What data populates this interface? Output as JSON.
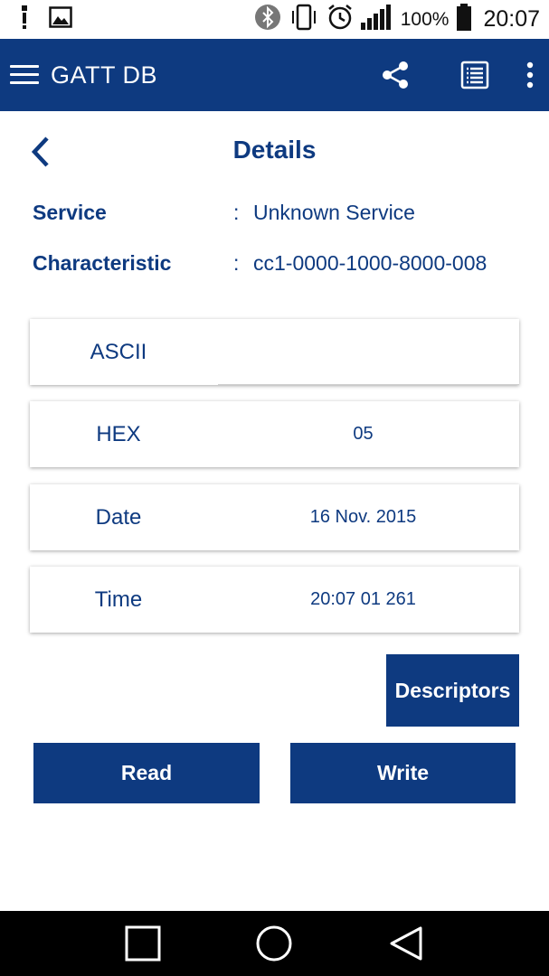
{
  "status_bar": {
    "battery_percent": "100%",
    "time": "20:07",
    "icons": [
      "flashlight-icon",
      "image-icon",
      "bluetooth-icon",
      "vibrate-icon",
      "alarm-icon",
      "signal-icon",
      "battery-icon"
    ]
  },
  "app_bar": {
    "title": "GATT DB",
    "icons": [
      "menu-icon",
      "share-icon",
      "list-icon",
      "more-vert-icon"
    ]
  },
  "page": {
    "title": "Details",
    "back_icon": "chevron-left-icon"
  },
  "info": {
    "service_label": "Service",
    "service_colon": ":",
    "service_value": "Unknown Service",
    "characteristic_label": "Characteristic",
    "characteristic_colon": ":",
    "characteristic_value": "cc1-0000-1000-8000-008"
  },
  "cards": [
    {
      "label": "ASCII",
      "value": ""
    },
    {
      "label": "HEX",
      "value": "05"
    },
    {
      "label": "Date",
      "value": "16 Nov. 2015"
    },
    {
      "label": "Time",
      "value": "20:07 01 261"
    }
  ],
  "buttons": {
    "descriptors": "Descriptors",
    "read": "Read",
    "write": "Write"
  },
  "nav_bar": {
    "icons": [
      "recent-apps-icon",
      "home-icon",
      "back-icon"
    ]
  },
  "colors": {
    "primary": "#0e3a80",
    "nav_background": "#000000",
    "background": "#ffffff"
  }
}
